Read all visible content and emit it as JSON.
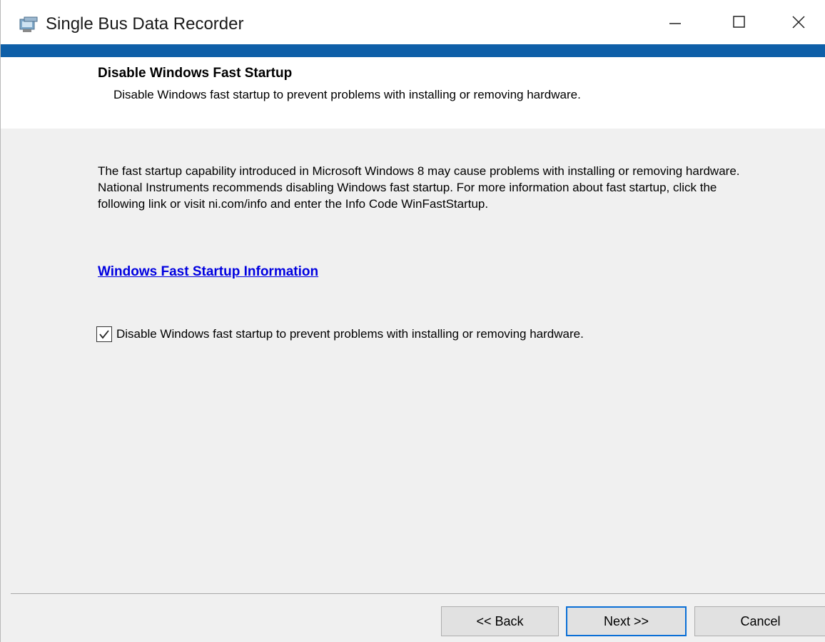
{
  "window": {
    "title": "Single Bus Data Recorder",
    "controls": {
      "minimize": "minimize-icon",
      "maximize": "maximize-icon",
      "close": "close-icon"
    },
    "accent_color": "#0e5fa8"
  },
  "header": {
    "title": "Disable Windows Fast Startup",
    "subtitle": "Disable Windows fast startup to prevent problems with installing or removing hardware."
  },
  "body": {
    "description": "The fast startup capability introduced in Microsoft Windows 8 may cause problems with installing or removing hardware. National Instruments recommends disabling Windows fast startup. For more information about fast startup, click the following link or visit ni.com/info and enter the Info Code WinFastStartup.",
    "link_text": "Windows Fast Startup Information",
    "checkbox": {
      "label": "Disable Windows fast startup to prevent problems with installing or removing hardware.",
      "checked": true
    }
  },
  "footer": {
    "back_label": "<< Back",
    "next_label": "Next >>",
    "cancel_label": "Cancel"
  }
}
